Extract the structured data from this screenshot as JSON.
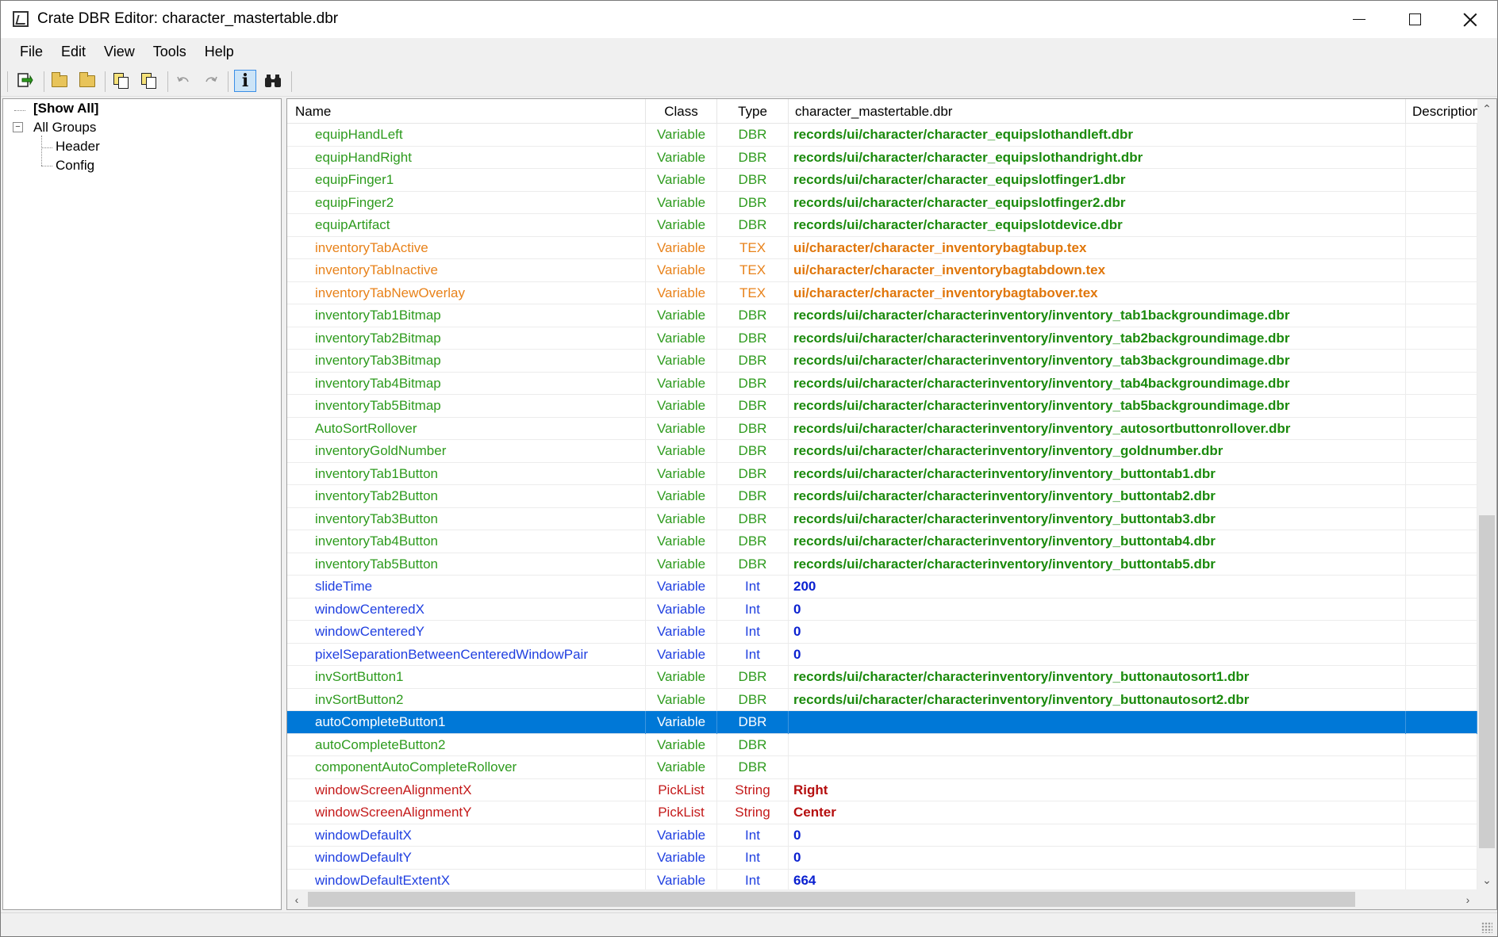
{
  "window": {
    "title": "Crate DBR Editor: character_mastertable.dbr"
  },
  "menu": [
    "File",
    "Edit",
    "View",
    "Tools",
    "Help"
  ],
  "toolbar": {
    "icons": [
      "open-record-icon",
      "open-folder-icon",
      "folder-icon",
      "copy-icon",
      "copy-alt-icon",
      "undo-icon",
      "redo-icon",
      "info-icon",
      "binoculars-icon"
    ],
    "info_label": "i"
  },
  "tree": {
    "show_all": "[Show All]",
    "all_groups": "All Groups",
    "children": [
      "Header",
      "Config"
    ]
  },
  "grid": {
    "columns": {
      "name": "Name",
      "class": "Class",
      "type": "Type",
      "value": "character_mastertable.dbr",
      "description": "Description"
    },
    "colors": {
      "dbr": "#2e9b1e",
      "dbr_value": "#1a8a0c",
      "tex": "#e8821a",
      "tex_value": "#e0760a",
      "int": "#1f3fe0",
      "int_value": "#0a20d0",
      "string": "#c41a1a",
      "string_value": "#b50e0e",
      "selected_bg": "#0078d7"
    },
    "rows": [
      {
        "name": "equipHandLeft",
        "class": "Variable",
        "type": "DBR",
        "value": "records/ui/character/character_equipslothandleft.dbr",
        "kind": "dbr"
      },
      {
        "name": "equipHandRight",
        "class": "Variable",
        "type": "DBR",
        "value": "records/ui/character/character_equipslothandright.dbr",
        "kind": "dbr"
      },
      {
        "name": "equipFinger1",
        "class": "Variable",
        "type": "DBR",
        "value": "records/ui/character/character_equipslotfinger1.dbr",
        "kind": "dbr"
      },
      {
        "name": "equipFinger2",
        "class": "Variable",
        "type": "DBR",
        "value": "records/ui/character/character_equipslotfinger2.dbr",
        "kind": "dbr"
      },
      {
        "name": "equipArtifact",
        "class": "Variable",
        "type": "DBR",
        "value": "records/ui/character/character_equipslotdevice.dbr",
        "kind": "dbr"
      },
      {
        "name": "inventoryTabActive",
        "class": "Variable",
        "type": "TEX",
        "value": "ui/character/character_inventorybagtabup.tex",
        "kind": "tex"
      },
      {
        "name": "inventoryTabInactive",
        "class": "Variable",
        "type": "TEX",
        "value": "ui/character/character_inventorybagtabdown.tex",
        "kind": "tex"
      },
      {
        "name": "inventoryTabNewOverlay",
        "class": "Variable",
        "type": "TEX",
        "value": "ui/character/character_inventorybagtabover.tex",
        "kind": "tex"
      },
      {
        "name": "inventoryTab1Bitmap",
        "class": "Variable",
        "type": "DBR",
        "value": "records/ui/character/characterinventory/inventory_tab1backgroundimage.dbr",
        "kind": "dbr"
      },
      {
        "name": "inventoryTab2Bitmap",
        "class": "Variable",
        "type": "DBR",
        "value": "records/ui/character/characterinventory/inventory_tab2backgroundimage.dbr",
        "kind": "dbr"
      },
      {
        "name": "inventoryTab3Bitmap",
        "class": "Variable",
        "type": "DBR",
        "value": "records/ui/character/characterinventory/inventory_tab3backgroundimage.dbr",
        "kind": "dbr"
      },
      {
        "name": "inventoryTab4Bitmap",
        "class": "Variable",
        "type": "DBR",
        "value": "records/ui/character/characterinventory/inventory_tab4backgroundimage.dbr",
        "kind": "dbr"
      },
      {
        "name": "inventoryTab5Bitmap",
        "class": "Variable",
        "type": "DBR",
        "value": "records/ui/character/characterinventory/inventory_tab5backgroundimage.dbr",
        "kind": "dbr"
      },
      {
        "name": "AutoSortRollover",
        "class": "Variable",
        "type": "DBR",
        "value": "records/ui/character/characterinventory/inventory_autosortbuttonrollover.dbr",
        "kind": "dbr"
      },
      {
        "name": "inventoryGoldNumber",
        "class": "Variable",
        "type": "DBR",
        "value": "records/ui/character/characterinventory/inventory_goldnumber.dbr",
        "kind": "dbr"
      },
      {
        "name": "inventoryTab1Button",
        "class": "Variable",
        "type": "DBR",
        "value": "records/ui/character/characterinventory/inventory_buttontab1.dbr",
        "kind": "dbr"
      },
      {
        "name": "inventoryTab2Button",
        "class": "Variable",
        "type": "DBR",
        "value": "records/ui/character/characterinventory/inventory_buttontab2.dbr",
        "kind": "dbr"
      },
      {
        "name": "inventoryTab3Button",
        "class": "Variable",
        "type": "DBR",
        "value": "records/ui/character/characterinventory/inventory_buttontab3.dbr",
        "kind": "dbr"
      },
      {
        "name": "inventoryTab4Button",
        "class": "Variable",
        "type": "DBR",
        "value": "records/ui/character/characterinventory/inventory_buttontab4.dbr",
        "kind": "dbr"
      },
      {
        "name": "inventoryTab5Button",
        "class": "Variable",
        "type": "DBR",
        "value": "records/ui/character/characterinventory/inventory_buttontab5.dbr",
        "kind": "dbr"
      },
      {
        "name": "slideTime",
        "class": "Variable",
        "type": "Int",
        "value": "200",
        "kind": "int"
      },
      {
        "name": "windowCenteredX",
        "class": "Variable",
        "type": "Int",
        "value": "0",
        "kind": "int"
      },
      {
        "name": "windowCenteredY",
        "class": "Variable",
        "type": "Int",
        "value": "0",
        "kind": "int"
      },
      {
        "name": "pixelSeparationBetweenCenteredWindowPair",
        "class": "Variable",
        "type": "Int",
        "value": "0",
        "kind": "int"
      },
      {
        "name": "invSortButton1",
        "class": "Variable",
        "type": "DBR",
        "value": "records/ui/character/characterinventory/inventory_buttonautosort1.dbr",
        "kind": "dbr"
      },
      {
        "name": "invSortButton2",
        "class": "Variable",
        "type": "DBR",
        "value": "records/ui/character/characterinventory/inventory_buttonautosort2.dbr",
        "kind": "dbr"
      },
      {
        "name": "autoCompleteButton1",
        "class": "Variable",
        "type": "DBR",
        "value": "",
        "kind": "dbr",
        "selected": true
      },
      {
        "name": "autoCompleteButton2",
        "class": "Variable",
        "type": "DBR",
        "value": "",
        "kind": "dbr"
      },
      {
        "name": "componentAutoCompleteRollover",
        "class": "Variable",
        "type": "DBR",
        "value": "",
        "kind": "dbr"
      },
      {
        "name": "windowScreenAlignmentX",
        "class": "PickList",
        "type": "String",
        "value": "Right",
        "kind": "string"
      },
      {
        "name": "windowScreenAlignmentY",
        "class": "PickList",
        "type": "String",
        "value": "Center",
        "kind": "string"
      },
      {
        "name": "windowDefaultX",
        "class": "Variable",
        "type": "Int",
        "value": "0",
        "kind": "int"
      },
      {
        "name": "windowDefaultY",
        "class": "Variable",
        "type": "Int",
        "value": "0",
        "kind": "int"
      },
      {
        "name": "windowDefaultExtentX",
        "class": "Variable",
        "type": "Int",
        "value": "664",
        "kind": "int"
      }
    ]
  }
}
